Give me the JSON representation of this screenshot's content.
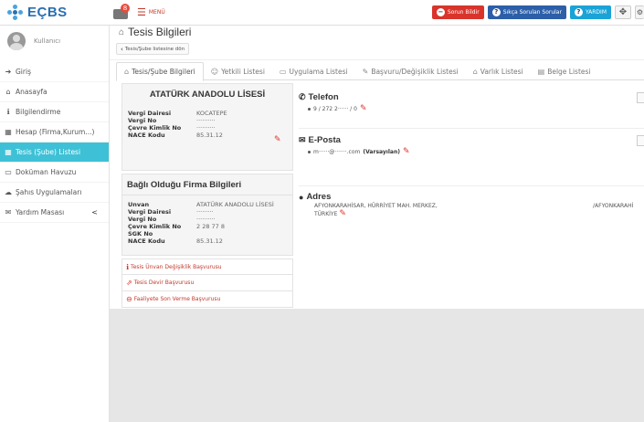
{
  "app": {
    "logo_text": "EÇBS",
    "mail_count": "8",
    "menu_label": "MENÜ"
  },
  "topbar": {
    "report_problem": "Sorun Bildir",
    "faq": "Sıkça Sorulan Sorular",
    "help": "YARDIM"
  },
  "user": {
    "name": "Kullanıcı"
  },
  "sidebar": {
    "items": [
      {
        "label": "Giriş",
        "icon": "sign-in-icon"
      },
      {
        "label": "Anasayfa",
        "icon": "home-icon"
      },
      {
        "label": "Bilgilendirme",
        "icon": "info-icon"
      },
      {
        "label": "Hesap (Firma,Kurum...)",
        "icon": "building-icon"
      },
      {
        "label": "Tesis (Şube) Listesi",
        "icon": "building-icon",
        "active": true
      },
      {
        "label": "Doküman Havuzu",
        "icon": "book-icon"
      },
      {
        "label": "Şahıs Uygulamaları",
        "icon": "cloud-icon"
      },
      {
        "label": "Yardım Masası",
        "icon": "envelope-icon",
        "caret": "<"
      }
    ]
  },
  "page": {
    "title": "Tesis Bilgileri",
    "back_label": "Tesis/Şube listesine dön"
  },
  "tabs": [
    {
      "label": "Tesis/Şube Bilgileri",
      "active": true
    },
    {
      "label": "Yetkili Listesi"
    },
    {
      "label": "Uygulama Listesi"
    },
    {
      "label": "Başvuru/Değişiklik Listesi"
    },
    {
      "label": "Varlık Listesi"
    },
    {
      "label": "Belge Listesi"
    }
  ],
  "facility": {
    "name": "ATATÜRK ANADOLU LİSESİ",
    "fields": [
      {
        "k": "Vergi Dairesi",
        "v": "KOCATEPE"
      },
      {
        "k": "Vergi No",
        "v": "··········"
      },
      {
        "k": "Çevre Kimlik No",
        "v": "··········"
      },
      {
        "k": "NACE Kodu",
        "v": "85.31.12"
      }
    ]
  },
  "firm": {
    "title": "Bağlı Olduğu Firma Bilgileri",
    "fields": [
      {
        "k": "Unvan",
        "v": "ATATÜRK ANADOLU LİSESİ"
      },
      {
        "k": "Vergi Dairesi",
        "v": "·········"
      },
      {
        "k": "Vergi No",
        "v": "··········"
      },
      {
        "k": "Çevre Kimlik No",
        "v": "2 28 77 8"
      },
      {
        "k": "SGK No",
        "v": ""
      },
      {
        "k": "NACE Kodu",
        "v": "85.31.12"
      }
    ]
  },
  "links": [
    {
      "label": "Tesis Ünvan Değişiklik Başvurusu",
      "icon": "info-icon"
    },
    {
      "label": "Tesis Devir Başvurusu",
      "icon": "external-icon"
    },
    {
      "label": "Faaliyete Son Verme Başvurusu",
      "icon": "stop-icon"
    }
  ],
  "contact": {
    "phone_title": "Telefon",
    "phone_value": "9 / 272 2······ / 0",
    "email_title": "E-Posta",
    "email_value": "m······@·······.com",
    "email_default": "(Varsayılan)",
    "address_title": "Adres",
    "address_value": "AFYONKARAHİSAR, HÜRRİYET MAH. MERKEZ, TÜRKİYE",
    "address_right": "/AFYONKARAHİ"
  },
  "colors": {
    "accent": "#3ec1d6",
    "danger": "#d9342b",
    "brand": "#2a6fb0"
  }
}
